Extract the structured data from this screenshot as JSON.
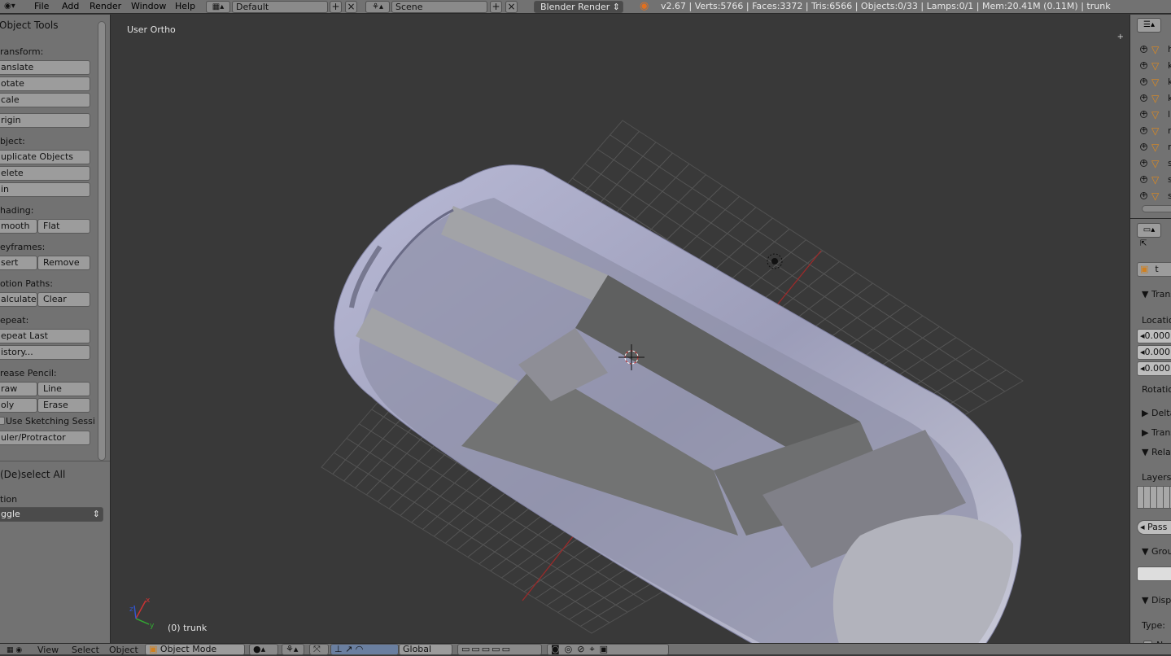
{
  "topbar": {
    "menus": [
      "File",
      "Add",
      "Render",
      "Window",
      "Help"
    ],
    "screen_layout": "Default",
    "scene": "Scene",
    "render_engine": "Blender Render",
    "stats": "v2.67 | Verts:5766 | Faces:3372 | Tris:6566 | Objects:0/33 | Lamps:0/1 | Mem:20.41M (0.11M) | trunk"
  },
  "toolshelf": {
    "title": "Object Tools",
    "transform_label": "ransform:",
    "translate": "anslate",
    "rotate": "otate",
    "scale": "cale",
    "origin": "rigin",
    "object_label": "bject:",
    "duplicate": "uplicate Objects",
    "delete": "elete",
    "join": "in",
    "shading_label": "hading:",
    "smooth": "mooth",
    "flat": "Flat",
    "keyframes_label": "eyframes:",
    "insert": "sert",
    "remove": "Remove",
    "motion_paths_label": "otion Paths:",
    "calculate": "alculate",
    "clear": "Clear",
    "repeat_label": "epeat:",
    "repeat_last": "epeat Last",
    "history": "istory...",
    "grease_pencil_label": "rease Pencil:",
    "draw": "raw",
    "line": "Line",
    "poly": "oly",
    "erase": "Erase",
    "sketching": "Use Sketching Sessi",
    "ruler": "uler/Protractor",
    "operator_title": "(De)select All",
    "action_label": "tion",
    "action_value": "ggle"
  },
  "viewport": {
    "view_name": "User Ortho",
    "object_label": "(0) trunk"
  },
  "outliner": {
    "items": [
      "h",
      "k",
      "k",
      "k",
      "li",
      "r",
      "r",
      "s",
      "s",
      "s"
    ]
  },
  "properties": {
    "object_name": "t",
    "transform_panel": "Trans",
    "location_label": "Location",
    "loc_x": "0.000",
    "loc_y": "0.000",
    "loc_z": "0.000",
    "rotation_label": "Rotatio",
    "delta_panel": "Delta",
    "transform2_panel": "Trans",
    "relations_panel": "Relat",
    "layers_label": "Layers:",
    "pass_label": "Pass",
    "groups_panel": "Grou",
    "display_panel": "Displ",
    "type_label": "Type:",
    "name_label": "Nan"
  },
  "bottombar": {
    "menus": [
      "View",
      "Select",
      "Object"
    ],
    "mode": "Object Mode",
    "orientation": "Global"
  },
  "colors": {
    "panel": "#727272",
    "viewport_bg": "#393939",
    "mesh": "#a8a9c6",
    "x_axis": "#9c2a2a",
    "y_axis": "#3b8a3b"
  }
}
